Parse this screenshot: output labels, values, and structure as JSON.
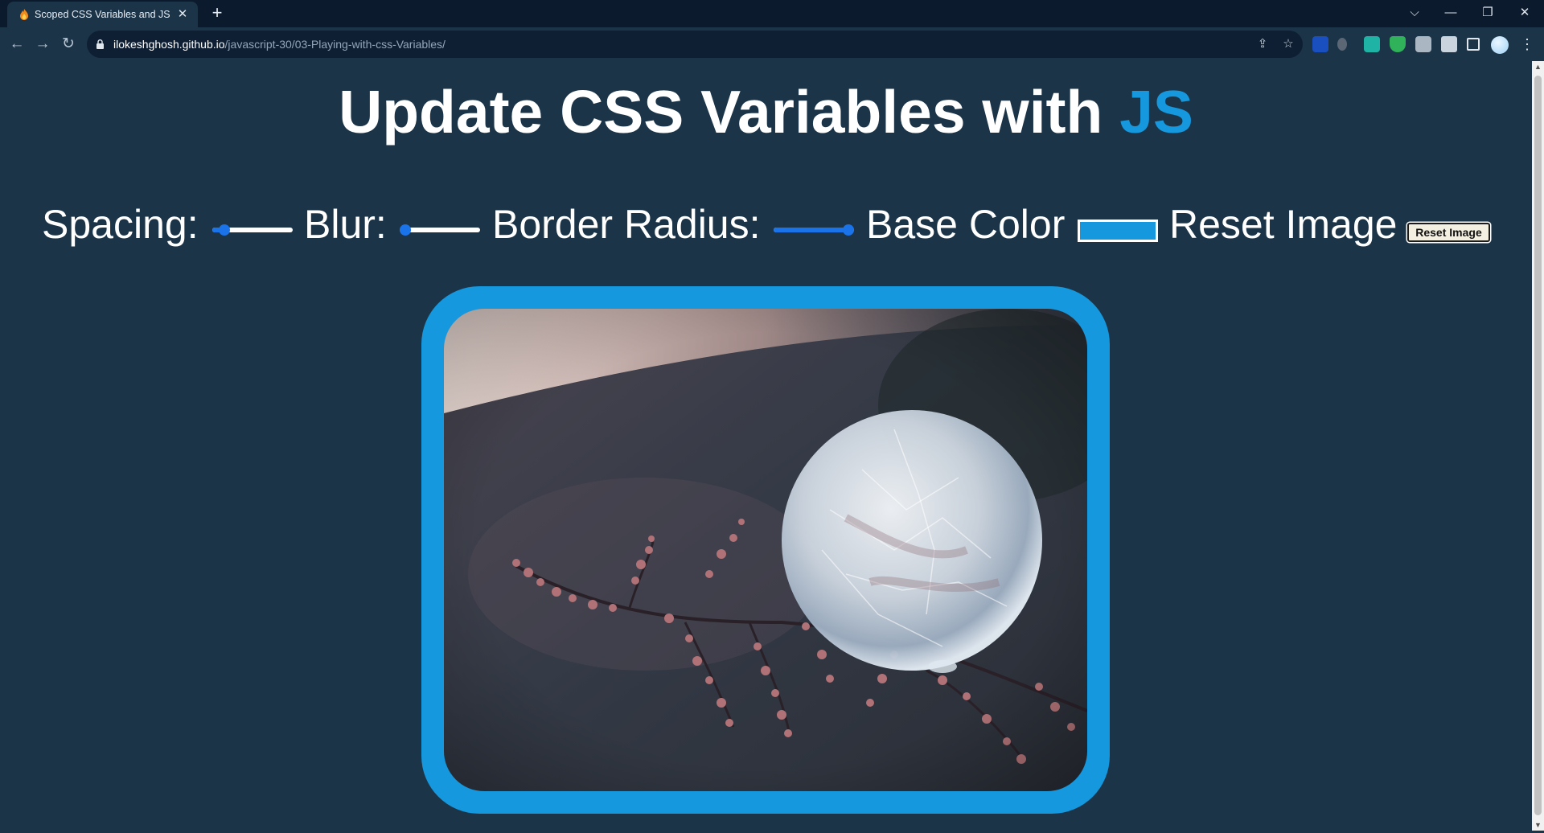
{
  "browser": {
    "tab_title": "Scoped CSS Variables and JS",
    "tab_close": "✕",
    "new_tab": "+",
    "url_host": "ilokeshghosh.github.io",
    "url_path": "/javascript-30/03-Playing-with-css-Variables/",
    "window_controls": {
      "collapse": "⌵",
      "minimize": "—",
      "restore": "❐",
      "close": "✕"
    },
    "nav": {
      "back": "←",
      "forward": "→",
      "reload": "↻"
    },
    "omnibox_icons": {
      "share": "⇪",
      "bookmark": "☆"
    },
    "menu": "⋮"
  },
  "page": {
    "title_main": "Update CSS Variables with ",
    "title_highlight": "JS"
  },
  "controls": {
    "spacing": {
      "label": "Spacing:",
      "fraction": 0.15
    },
    "blur": {
      "label": "Blur:",
      "fraction": 0.05
    },
    "radius": {
      "label": "Border Radius:",
      "fraction": 0.95
    },
    "base_color": {
      "label": "Base Color",
      "value": "#1598de"
    },
    "reset": {
      "label": "Reset Image",
      "button": "Reset Image"
    }
  },
  "colors": {
    "background": "#1b3448",
    "accent": "#1598de",
    "slider": "#1a73e8"
  },
  "scrollbar": {
    "up": "▲",
    "down": "▼"
  }
}
